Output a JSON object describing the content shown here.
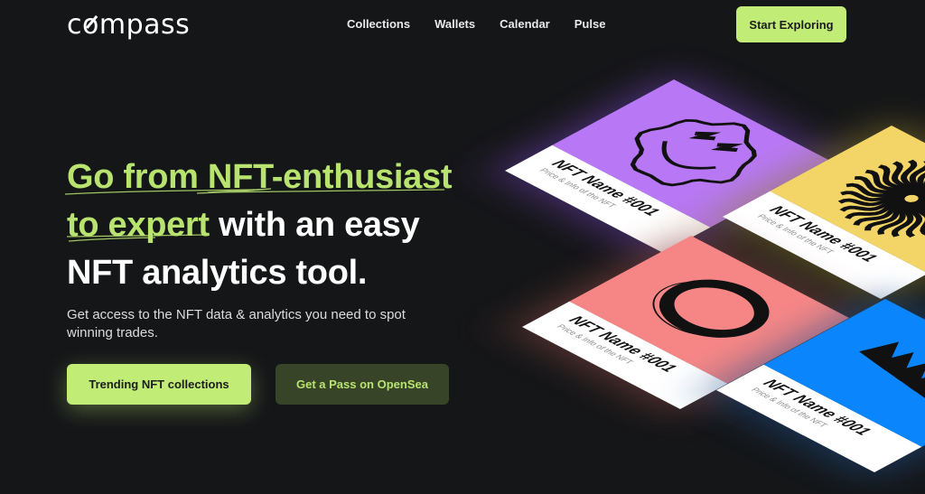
{
  "nav": {
    "logo": "compass",
    "links": [
      "Collections",
      "Wallets",
      "Calendar",
      "Pulse"
    ],
    "cta": "Start Exploring"
  },
  "hero": {
    "title_highlight_1": "Go from NFT-enthusiast",
    "title_highlight_2": "to expert",
    "title_rest_1": " with an easy",
    "title_rest_2": "NFT analytics tool.",
    "subtitle": "Get access to the NFT data & analytics you need to spot winning trades.",
    "primary_button": "Trending NFT collections",
    "secondary_button": "Get a Pass on OpenSea"
  },
  "colors": {
    "background": "#151618",
    "accent": "#c1ec76",
    "accent_text": "#b8e36f",
    "secondary_button_bg": "#374427"
  },
  "cards": [
    {
      "name": "NFT Name #001",
      "info": "Price & Info of the NFT",
      "color": "#b878f5",
      "glow": "#6a3fb0",
      "art": "smiley-icon"
    },
    {
      "name": "NFT Name #001",
      "info": "Price & Info of the NFT",
      "color": "#f3d466",
      "glow": "#8a7a2a",
      "art": "sunburst-icon"
    },
    {
      "name": "NFT Name #001",
      "info": "Price & Info of the NFT",
      "color": "#f68686",
      "glow": "#8c4a44",
      "art": "ring-icon"
    },
    {
      "name": "NFT Name #001",
      "info": "Price & Info of the NFT",
      "color": "#0a85fc",
      "glow": "#1f4f8a",
      "art": "zigzag-icon"
    }
  ]
}
